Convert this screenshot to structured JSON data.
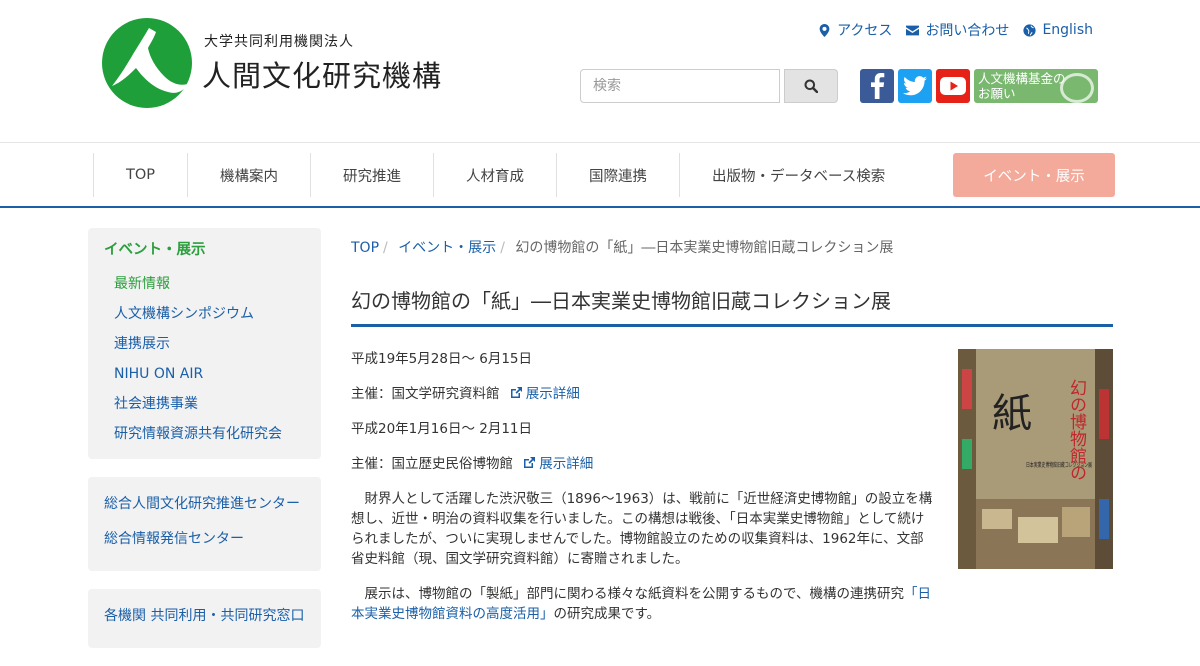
{
  "header": {
    "org_sub": "大学共同利用機関法人",
    "org_name": "人間文化研究機構",
    "util_links": {
      "access": "アクセス",
      "contact": "お問い合わせ",
      "english": "English"
    },
    "search": {
      "placeholder": "検索"
    },
    "fund_banner": "人文機構基金の\nお願い"
  },
  "nav": {
    "items": [
      "TOP",
      "機構案内",
      "研究推進",
      "人材育成",
      "国際連携",
      "出版物・データベース検索",
      "イベント・展示"
    ]
  },
  "sidebar": {
    "section_title": "イベント・展示",
    "items": [
      "最新情報",
      "人文機構シンポジウム",
      "連携展示",
      "NIHU ON AIR",
      "社会連携事業",
      "研究情報資源共有化研究会"
    ],
    "box2": [
      "総合人間文化研究推進センター",
      "総合情報発信センター"
    ],
    "box3": [
      "各機関 共同利用・共同研究窓口"
    ]
  },
  "breadcrumb": [
    "TOP",
    "イベント・展示",
    "幻の博物館の「紙」―日本実業史博物館旧蔵コレクション展"
  ],
  "page_title": "幻の博物館の「紙」―日本実業史博物館旧蔵コレクション展",
  "content": {
    "date1": "平成19年5月28日～ 6月15日",
    "host1": "主催：国文学研究資料館",
    "detail_link1": "展示詳細",
    "date2": "平成20年1月16日～ 2月11日",
    "host2": "主催：国立歴史民俗博物館",
    "detail_link2": "展示詳細",
    "para1": "財界人として活躍した渋沢敬三（1896～1963）は、戦前に「近世経済史博物館」の設立を構想し、近世・明治の資料収集を行いました。この構想は戦後、「日本実業史博物館」として続けられましたが、ついに実現しませんでした。博物館設立のための収集資料は、1962年に、文部省史料館（現、国文学研究資料館）に寄贈されました。",
    "para2_pre": "展示は、博物館の「製紙」部門に関わる様々な紙資料を公開するもので、機構の連携研究",
    "para2_link": "「日本実業史博物館資料の高度活用」",
    "para2_post": "の研究成果です。",
    "poster": {
      "title": "幻の博物館の",
      "kanji": "紙",
      "caption": "日本実業史博物館旧蔵コレクション展"
    }
  },
  "colors": {
    "brand_blue": "#1a5fa8",
    "brand_green": "#2b9e3d",
    "nav_active": "#f3aa9a"
  }
}
